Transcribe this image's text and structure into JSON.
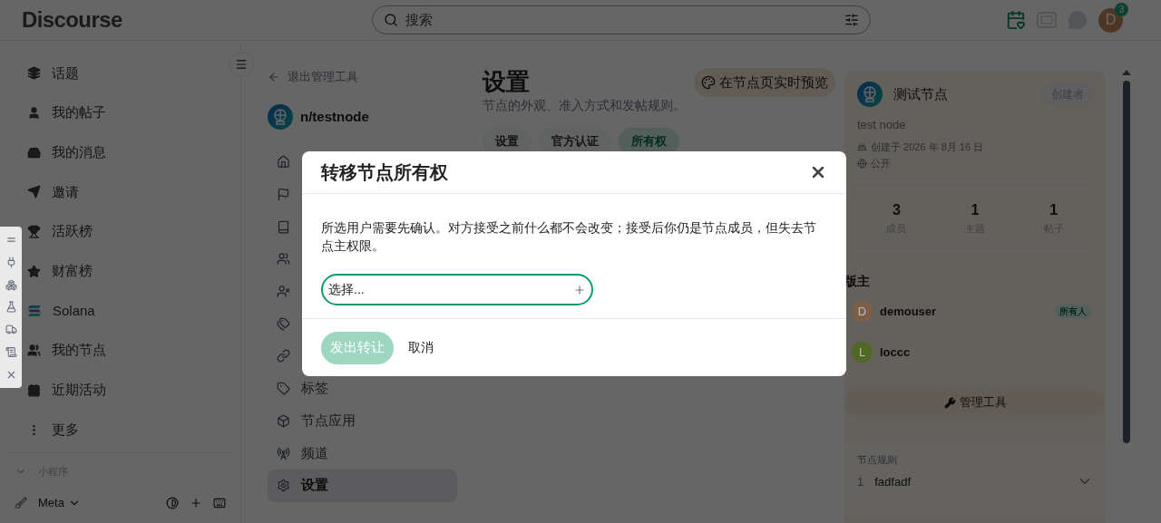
{
  "header": {
    "logo": "Discourse",
    "search": {
      "placeholder": "搜索"
    },
    "avatar": "D",
    "notifications": "3"
  },
  "sidebar": {
    "items": [
      {
        "label": "话题"
      },
      {
        "label": "我的帖子"
      },
      {
        "label": "我的消息"
      },
      {
        "label": "邀请"
      },
      {
        "label": "活跃榜"
      },
      {
        "label": "财富榜"
      },
      {
        "label": "Solana"
      },
      {
        "label": "我的节点"
      },
      {
        "label": "近期活动"
      },
      {
        "label": "更多"
      }
    ],
    "section": {
      "label": "小程序",
      "expanded": true
    },
    "footer": "Meta"
  },
  "admin_nav": {
    "back": "退出管理工具",
    "node": "n/testnode",
    "items": [
      {
        "kind": "covered"
      },
      {
        "kind": "covered"
      },
      {
        "kind": "covered"
      },
      {
        "kind": "covered"
      },
      {
        "kind": "covered"
      },
      {
        "kind": "covered"
      },
      {
        "kind": "covered"
      },
      {
        "kind": "link",
        "label": "标签",
        "selected": false
      },
      {
        "kind": "link",
        "label": "节点应用",
        "selected": false
      },
      {
        "kind": "link",
        "label": "频道",
        "selected": false
      },
      {
        "kind": "link",
        "label": "设置",
        "selected": true
      }
    ]
  },
  "main": {
    "title": "设置",
    "subtitle": "节点的外观、准入方式和发帖规则。",
    "preview_button": "在节点页实时预览",
    "tabs": [
      {
        "label": "设置",
        "selected": false
      },
      {
        "label": "官方认证",
        "selected": false
      },
      {
        "label": "所有权",
        "selected": true
      }
    ]
  },
  "node_card": {
    "name": "测试节点",
    "role": "创建者",
    "description": "test node",
    "created": "创建于 2026 年 8月 16 日",
    "visibility": "公开",
    "stats": [
      {
        "value": "3",
        "label": "成员"
      },
      {
        "value": "1",
        "label": "主题"
      },
      {
        "value": "1",
        "label": "帖子"
      }
    ],
    "moderators_heading": "版主",
    "moderators": [
      {
        "initial": "D",
        "name": "demouser",
        "color": "#7d5e48",
        "tag": "所有人"
      },
      {
        "initial": "L",
        "name": "loccc",
        "color": "#4f6824"
      }
    ],
    "tools_button": "管理工具",
    "rules_heading": "节点规则",
    "rules": [
      {
        "number": "1",
        "text": "fadfadf"
      }
    ]
  },
  "modal": {
    "title": "转移节点所有权",
    "body": "所选用户需要先确认。对方接受之前什么都不会改变；接受后你仍是节点成员，但失去节点主权限。",
    "select": {
      "placeholder": "选择..."
    },
    "submit": {
      "label": "发出转让",
      "disabled": true
    },
    "cancel": "取消"
  }
}
